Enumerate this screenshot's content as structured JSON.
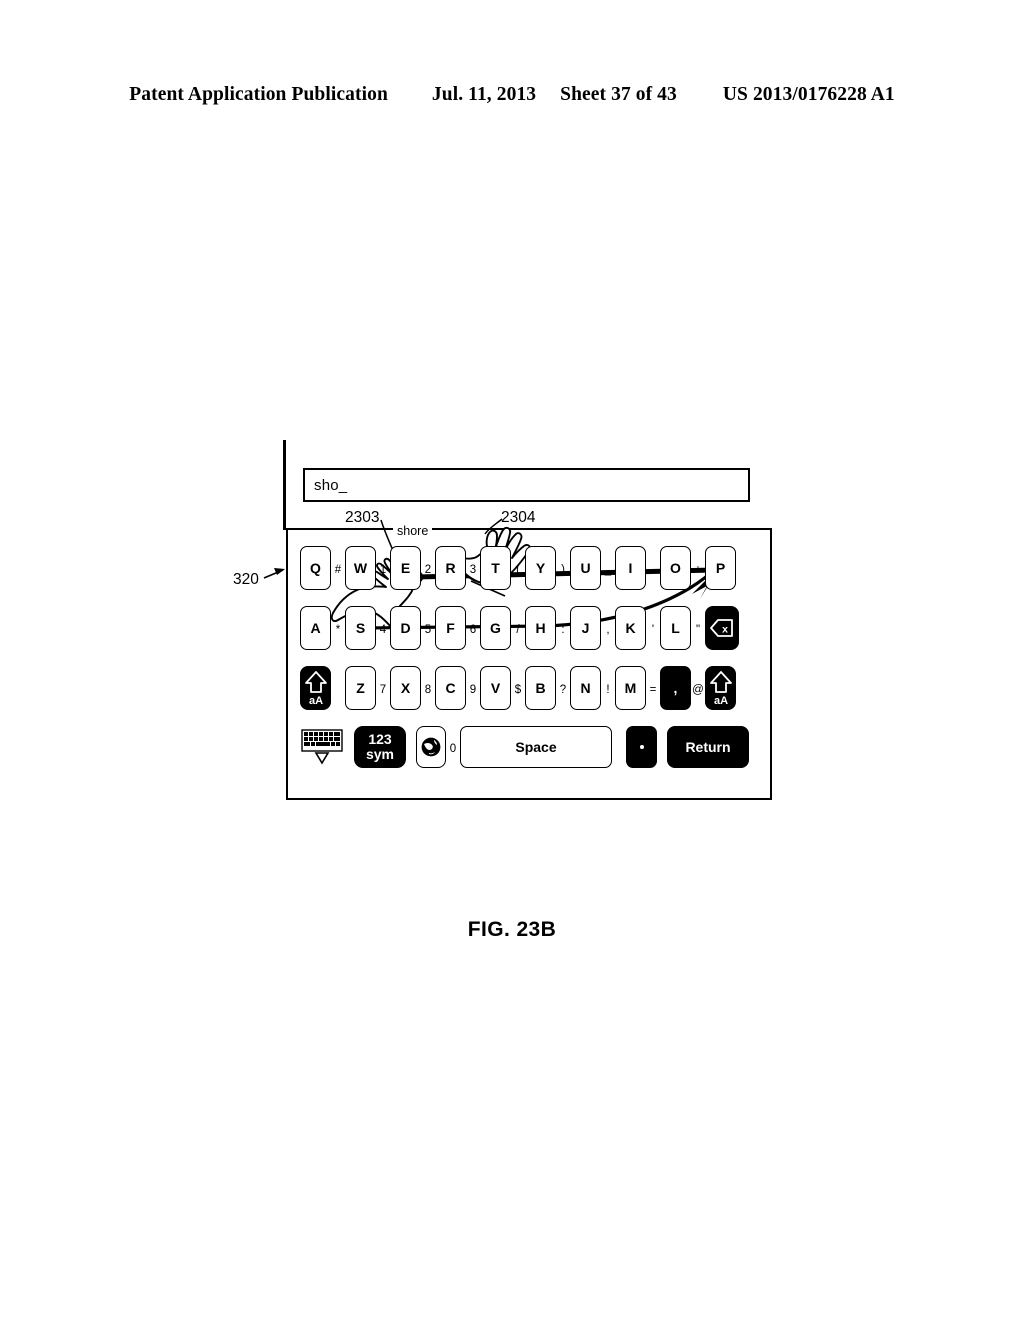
{
  "header": {
    "publication": "Patent Application Publication",
    "date": "Jul. 11, 2013",
    "sheet": "Sheet 37 of 43",
    "patent_number": "US 2013/0176228 A1"
  },
  "figure": {
    "caption": "FIG. 23B"
  },
  "callouts": {
    "device": "320",
    "hand_left": "2303",
    "hand_right": "2304"
  },
  "text_field": {
    "value": "sho_"
  },
  "suggestion": {
    "word": "shore"
  },
  "keyboard": {
    "row1": [
      {
        "type": "key",
        "label": "Q"
      },
      {
        "type": "alt",
        "label": "#"
      },
      {
        "type": "key",
        "label": "W"
      },
      {
        "type": "alt",
        "label": "1"
      },
      {
        "type": "key",
        "label": "E"
      },
      {
        "type": "alt",
        "label": "2"
      },
      {
        "type": "key",
        "label": "R"
      },
      {
        "type": "alt",
        "label": "3"
      },
      {
        "type": "key",
        "label": "T"
      },
      {
        "type": "alt",
        "label": "("
      },
      {
        "type": "key",
        "label": "Y"
      },
      {
        "type": "alt",
        "label": ")"
      },
      {
        "type": "key",
        "label": "U"
      },
      {
        "type": "alt",
        "label": "_"
      },
      {
        "type": "key",
        "label": "I"
      },
      {
        "type": "alt",
        "label": "-"
      },
      {
        "type": "key",
        "label": "O"
      },
      {
        "type": "alt",
        "label": "+"
      },
      {
        "type": "key",
        "label": "P"
      }
    ],
    "row2": [
      {
        "type": "key",
        "label": "A"
      },
      {
        "type": "alt",
        "label": "*"
      },
      {
        "type": "key",
        "label": "S"
      },
      {
        "type": "alt",
        "label": "4"
      },
      {
        "type": "key",
        "label": "D"
      },
      {
        "type": "alt",
        "label": "5"
      },
      {
        "type": "key",
        "label": "F"
      },
      {
        "type": "alt",
        "label": "6"
      },
      {
        "type": "key",
        "label": "G"
      },
      {
        "type": "alt",
        "label": "/"
      },
      {
        "type": "key",
        "label": "H"
      },
      {
        "type": "alt",
        "label": ":"
      },
      {
        "type": "key",
        "label": "J"
      },
      {
        "type": "alt",
        "label": ","
      },
      {
        "type": "key",
        "label": "K"
      },
      {
        "type": "alt",
        "label": "'"
      },
      {
        "type": "key",
        "label": "L"
      },
      {
        "type": "alt",
        "label": "\""
      },
      {
        "type": "backspace",
        "label": "backspace-icon"
      }
    ],
    "row3": [
      {
        "type": "shift",
        "label": "aA"
      },
      {
        "type": "key",
        "label": "Z"
      },
      {
        "type": "alt",
        "label": "7"
      },
      {
        "type": "key",
        "label": "X"
      },
      {
        "type": "alt",
        "label": "8"
      },
      {
        "type": "key",
        "label": "C"
      },
      {
        "type": "alt",
        "label": "9"
      },
      {
        "type": "key",
        "label": "V"
      },
      {
        "type": "alt",
        "label": "$"
      },
      {
        "type": "key",
        "label": "B"
      },
      {
        "type": "alt",
        "label": "?"
      },
      {
        "type": "key",
        "label": "N"
      },
      {
        "type": "alt",
        "label": "!"
      },
      {
        "type": "key",
        "label": "M"
      },
      {
        "type": "alt",
        "label": "="
      },
      {
        "type": "key_dark",
        "label": ","
      },
      {
        "type": "alt",
        "label": "@"
      },
      {
        "type": "shift",
        "label": "aA"
      }
    ],
    "row4": {
      "hide_keyboard": "hide-keyboard-icon",
      "sym_line1": "123",
      "sym_line2": "sym",
      "globe": "globe-icon",
      "globe_alt": "0",
      "space": "Space",
      "period": ".",
      "return": "Return"
    }
  }
}
